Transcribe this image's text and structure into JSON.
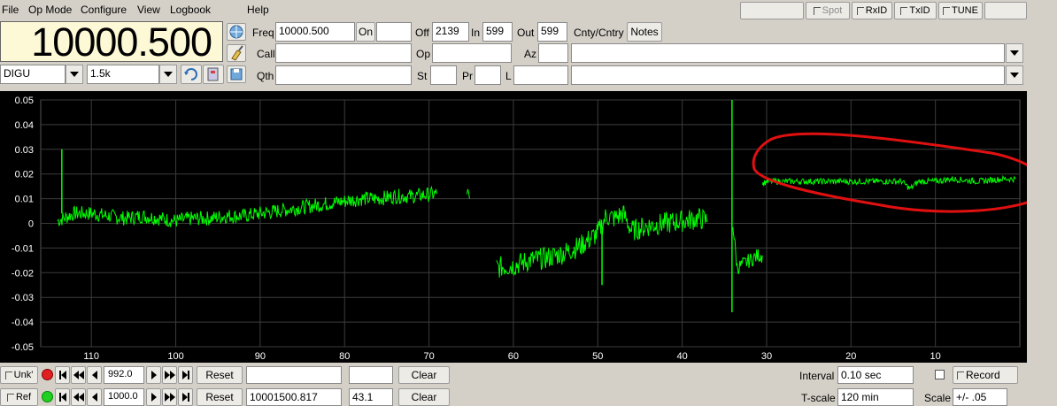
{
  "menu": [
    "File",
    "Op Mode",
    "Configure",
    "View",
    "Logbook",
    "Help"
  ],
  "top_buttons": {
    "spot": "Spot",
    "rxid": "RxID",
    "txid": "TxID",
    "tune": "TUNE"
  },
  "frequency_display": "10000.500",
  "mode": "DIGU",
  "bandwidth": "1.5k",
  "log": {
    "freq_label": "Freq",
    "freq_value": "10000.500",
    "on_label": "On",
    "on_value": "",
    "off_label": "Off",
    "off_value": "2139",
    "in_label": "In",
    "in_value": "599",
    "out_label": "Out",
    "out_value": "599",
    "cnty_label": "Cnty/Cntry",
    "notes_label": "Notes",
    "call_label": "Call",
    "call_value": "",
    "op_label": "Op",
    "op_value": "",
    "az_label": "Az",
    "az_value": "",
    "qth_label": "Qth",
    "qth_value": "",
    "st_label": "St",
    "st_value": "",
    "pr_label": "Pr",
    "pr_value": "",
    "l_label": "L",
    "l_value": ""
  },
  "chart_data": {
    "type": "line",
    "title": "",
    "xlabel": "",
    "ylabel": "",
    "xlim": [
      116,
      0
    ],
    "ylim": [
      -0.05,
      0.05
    ],
    "x_ticks": [
      "110",
      "100",
      "90",
      "80",
      "70",
      "60",
      "50",
      "40",
      "30",
      "20",
      "10"
    ],
    "y_ticks": [
      "0.05",
      "0.04",
      "0.03",
      "0.02",
      "0.01",
      "0",
      "-0.01",
      "-0.02",
      "-0.03",
      "-0.04",
      "-0.05"
    ],
    "grid": true,
    "annotation": "red ellipse around trace from x≈31 to x≈0",
    "series": [
      {
        "color": "#00ff00",
        "segments": [
          {
            "x": [
              114,
              112,
              110,
              108,
              106,
              104,
              102,
              100,
              98,
              96,
              94,
              92,
              90,
              88,
              86,
              84,
              82,
              80,
              78,
              76,
              74,
              72,
              69
            ],
            "y": [
              0.001,
              0.004,
              0.004,
              0.003,
              0.002,
              0.003,
              0.002,
              0.001,
              0.002,
              0.002,
              0.003,
              0.003,
              0.004,
              0.005,
              0.006,
              0.007,
              0.008,
              0.009,
              0.01,
              0.01,
              0.011,
              0.011,
              0.012
            ]
          },
          {
            "x": [
              65.5,
              65.2
            ],
            "y": [
              0.013,
              0.01
            ]
          },
          {
            "x": [
              62,
              60,
              58,
              56,
              54,
              52,
              50,
              49,
              48,
              47,
              46,
              44,
              42,
              40,
              38,
              37
            ],
            "y": [
              -0.018,
              -0.017,
              -0.015,
              -0.014,
              -0.012,
              -0.009,
              -0.004,
              0.003,
              0.002,
              0.004,
              -0.003,
              -0.001,
              0.0,
              0.001,
              0.002,
              0.001
            ]
          },
          {
            "x": [
              34,
              33.5,
              33,
              32,
              31,
              30.5
            ],
            "y": [
              0.0,
              -0.018,
              -0.017,
              -0.015,
              -0.013,
              -0.013
            ]
          },
          {
            "x": [
              30.5,
              30,
              28,
              25,
              22,
              19,
              16,
              14,
              13,
              12,
              10,
              8,
              5,
              2,
              0.5
            ],
            "y": [
              0.016,
              0.017,
              0.017,
              0.017,
              0.017,
              0.017,
              0.017,
              0.017,
              0.014,
              0.017,
              0.017,
              0.018,
              0.017,
              0.018,
              0.018
            ]
          }
        ],
        "spikes": [
          {
            "x": 113.5,
            "y_top": 0.03,
            "y_bottom": 0.004
          },
          {
            "x": 34.1,
            "y_top": 0.05,
            "y_bottom": -0.036
          },
          {
            "x": 49.5,
            "y_top": -0.003,
            "y_bottom": -0.025
          }
        ]
      }
    ]
  },
  "bottom": {
    "unk_label": "Unk'",
    "pos_value": "992.0",
    "reset_label": "Reset",
    "text_value": "",
    "small_value": "",
    "clear_label": "Clear",
    "interval_label": "Interval",
    "interval_value": "0.10 sec",
    "record_label": "Record"
  },
  "bottom2": {
    "ref_label": "Ref",
    "pos_value": "1000.0",
    "reset_label": "Reset",
    "freq_value": "10001500.817",
    "small_value": "43.1",
    "clear_label": "Clear",
    "tscale_label": "T-scale",
    "tscale_value": "120 min",
    "scale_label": "Scale",
    "scale_value": "+/- .05"
  },
  "colors": {
    "trace": "#00ff00",
    "grid": "#3c3c3c",
    "annotation": "#e01010",
    "freq_bg": "#fdf8d6"
  }
}
